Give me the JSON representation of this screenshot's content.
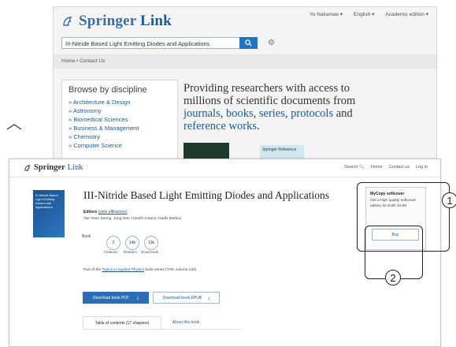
{
  "back_window": {
    "logo_springer": "Springer",
    "logo_link": "Link",
    "top_links": [
      "Yo Nakamae ▾",
      "English ▾",
      "Academic edition ▾"
    ],
    "search_value": "III-Nitride Based Light Emitting Diodes and Applications",
    "breadcrumbs": "Home  •  Contact Us",
    "browse_title": "Browse by discipline",
    "disciplines": [
      "» Architecture & Design",
      "» Astronomy",
      "» Biomedical Sciences",
      "» Business & Management",
      "» Chemistry",
      "» Computer Science"
    ],
    "hero_line1": "Providing researchers with access to",
    "hero_line2": "millions of scientific documents from",
    "hero_links": {
      "journals": "journals",
      "books": "books",
      "series": "series",
      "protocols": "protocols",
      "reference": "reference works"
    },
    "hero_words": {
      "sep1": ", ",
      "sep2": ", ",
      "sep3": ", ",
      "and": " and",
      "end": "."
    },
    "thumb2_text": "Springer Reference"
  },
  "front_window": {
    "logo_springer": "Springer",
    "logo_link": "Link",
    "nav": [
      "Search",
      "Home",
      "Contact us",
      "Log in"
    ],
    "cover_text": "III-Nitride Based Light Emitting Diodes and Applications",
    "title": "III-Nitride Based Light Emitting Diodes and Applications",
    "editors_label": "Editors",
    "view_affiliations": "(view affiliations)",
    "names": "Tae-Yeon Seong, Jung Han, Hiroshi Amano, Hadis Morkoç",
    "book_label": "Book",
    "metrics": [
      {
        "value": "2",
        "label": "Citations"
      },
      {
        "value": "14k",
        "label": "Readers"
      },
      {
        "value": "13k",
        "label": "Downloads"
      }
    ],
    "series_prefix": "Part of the ",
    "series_link": "Topics in Applied Physics",
    "series_suffix": " book series (TAP, volume 133)",
    "download_pdf": "Download book PDF",
    "download_epub": "Download book EPUB",
    "tab_contents": "Table of contents (17 chapters)",
    "tab_about": "About this book",
    "mycopy_title": "MyCopy softcover",
    "mycopy_desc": "Get a high quality softcover edition for EUR 24.99",
    "buy": "Buy"
  },
  "annotations": {
    "one": "1",
    "two": "2"
  }
}
